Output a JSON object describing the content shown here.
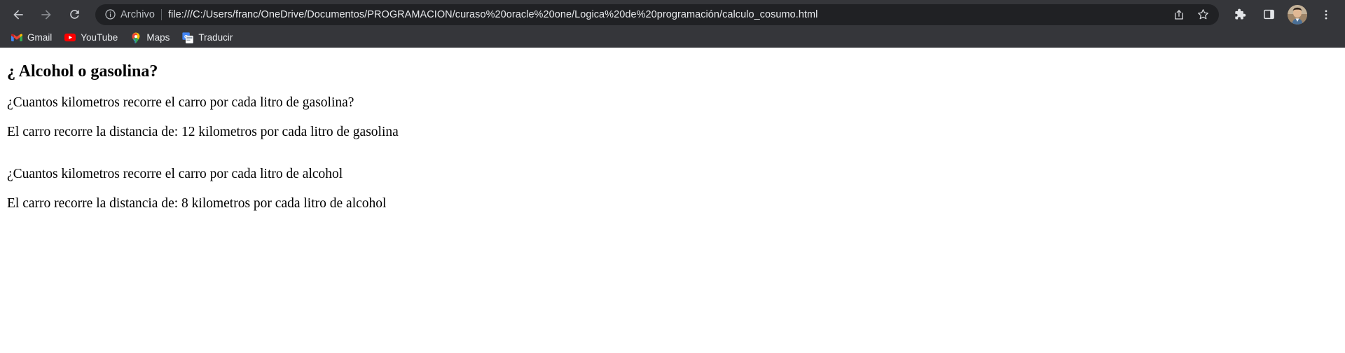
{
  "browser": {
    "nav": {
      "back_label": "Back",
      "forward_label": "Forward",
      "reload_label": "Reload"
    },
    "omnibox": {
      "scheme_label": "Archivo",
      "url": "file:///C:/Users/franc/OneDrive/Documentos/PROGRAMACION/curaso%20oracle%20one/Logica%20de%20programación/calculo_cosumo.html",
      "site_info_icon": "info-circle-icon",
      "share_label": "Share this page",
      "bookmark_label": "Bookmark this tab"
    },
    "actions": {
      "extensions_label": "Extensions",
      "side_panel_label": "Side panel",
      "profile_label": "Profile",
      "menu_label": "Customize and control Google Chrome"
    },
    "bookmarks": [
      {
        "label": "Gmail",
        "icon": "gmail-icon"
      },
      {
        "label": "YouTube",
        "icon": "youtube-icon"
      },
      {
        "label": "Maps",
        "icon": "google-maps-icon"
      },
      {
        "label": "Traducir",
        "icon": "google-translate-icon"
      }
    ],
    "colors": {
      "toolbar_bg": "#35363a",
      "omnibox_bg": "#202124",
      "toolbar_text": "#e8eaed",
      "toolbar_text_dim": "#bdc1c6",
      "page_bg": "#ffffff",
      "page_text": "#000000"
    }
  },
  "page": {
    "heading": "¿ Alcohol o gasolina?",
    "paragraphs": [
      "¿Cuantos kilometros recorre el carro por cada litro de gasolina?",
      "El carro recorre la distancia de: 12 kilometros por cada litro de gasolina",
      "¿Cuantos kilometros recorre el carro por cada litro de alcohol",
      "El carro recorre la distancia de: 8 kilometros por cada litro de alcohol"
    ]
  }
}
